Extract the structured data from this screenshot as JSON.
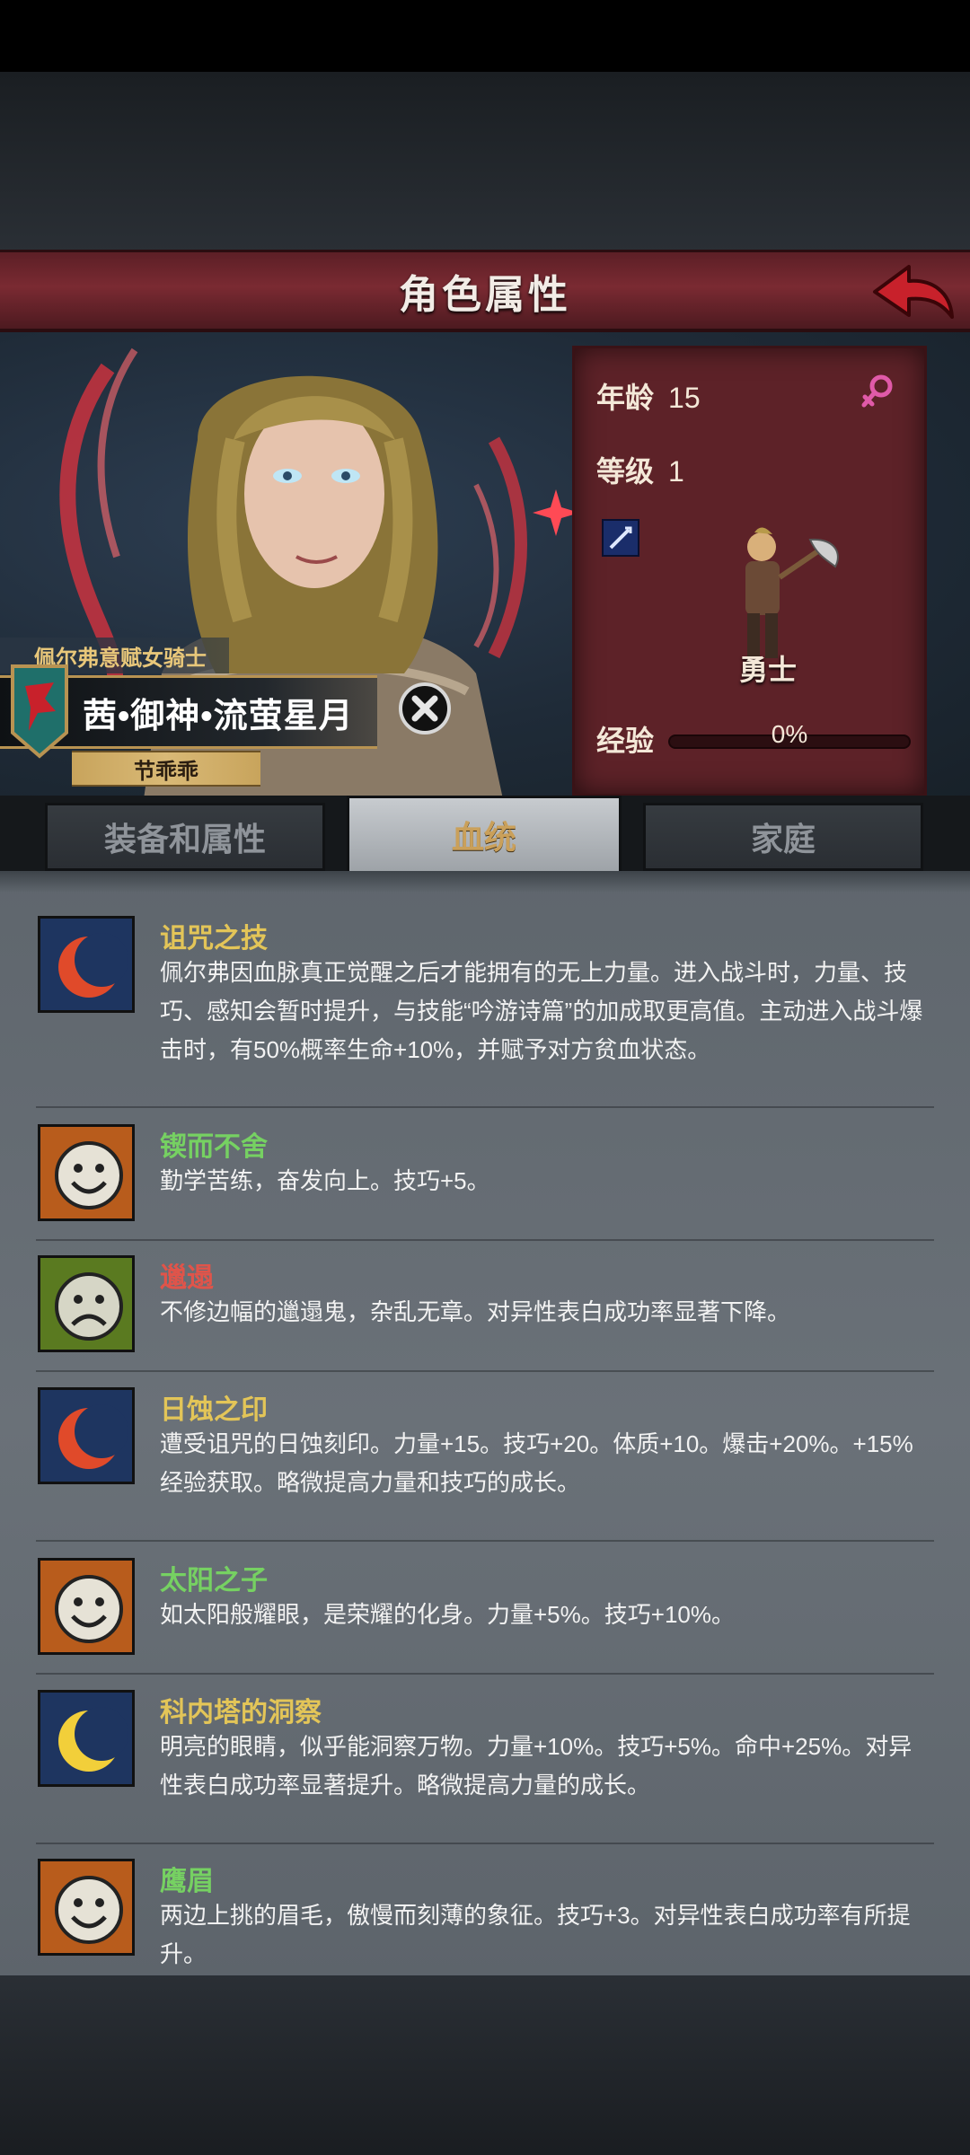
{
  "header": {
    "title": "角色属性"
  },
  "character": {
    "title_badge": "佩尔弗意赋女骑士",
    "name": "茜•御神•流萤星月",
    "nickname": "节乖乖"
  },
  "stats": {
    "age_label": "年龄",
    "age_value": "15",
    "level_label": "等级",
    "level_value": "1",
    "class_name": "勇士",
    "exp_label": "经验",
    "exp_value": "0%",
    "exp_fraction": 0
  },
  "tabs": [
    {
      "label": "装备和属性",
      "active": false
    },
    {
      "label": "血统",
      "active": true
    },
    {
      "label": "家庭",
      "active": false
    }
  ],
  "traits": [
    {
      "name": "诅咒之技",
      "color": "yellow",
      "icon": "red-crescent-icon",
      "desc": "佩尔弗因血脉真正觉醒之后才能拥有的无上力量。进入战斗时，力量、技巧、感知会暂时提升，与技能“吟游诗篇”的加成取更高值。主动进入战斗爆击时，有50%概率生命+10%，并赋予对方贫血状态。"
    },
    {
      "name": "锲而不舍",
      "color": "green",
      "icon": "smile-face-icon",
      "desc": "勤学苦练，奋发向上。技巧+5。"
    },
    {
      "name": "邋遢",
      "color": "red",
      "icon": "frown-face-icon",
      "desc": "不修边幅的邋遢鬼，杂乱无章。对异性表白成功率显著下降。"
    },
    {
      "name": "日蚀之印",
      "color": "yellow",
      "icon": "red-crescent-icon",
      "desc": "遭受诅咒的日蚀刻印。力量+15。技巧+20。体质+10。爆击+20%。+15%经验获取。略微提高力量和技巧的成长。"
    },
    {
      "name": "太阳之子",
      "color": "green",
      "icon": "smile-face-icon",
      "desc": "如太阳般耀眼，是荣耀的化身。力量+5%。技巧+10%。"
    },
    {
      "name": "科内塔的洞察",
      "color": "yellow",
      "icon": "yellow-crescent-icon",
      "desc": "明亮的眼睛，似乎能洞察万物。力量+10%。技巧+5%。命中+25%。对异性表白成功率显著提升。略微提高力量的成长。"
    },
    {
      "name": "鹰眉",
      "color": "green",
      "icon": "smile-face-icon",
      "desc": "两边上挑的眉毛，傲慢而刻薄的象征。技巧+3。对异性表白成功率有所提升。"
    }
  ]
}
